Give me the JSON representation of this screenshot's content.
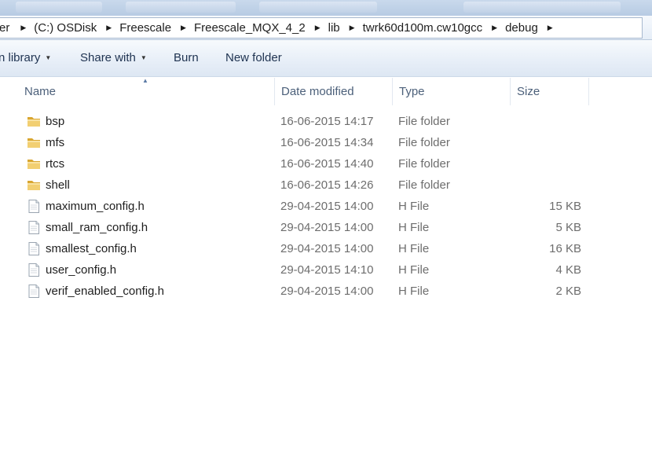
{
  "breadcrumb": {
    "items": [
      {
        "label": "er"
      },
      {
        "label": "(C:) OSDisk"
      },
      {
        "label": "Freescale"
      },
      {
        "label": "Freescale_MQX_4_2"
      },
      {
        "label": "lib"
      },
      {
        "label": "twrk60d100m.cw10gcc"
      },
      {
        "label": "debug"
      }
    ]
  },
  "toolbar": {
    "include_library": "n library",
    "share_with": "Share with",
    "burn": "Burn",
    "new_folder": "New folder"
  },
  "columns": {
    "name": "Name",
    "date_modified": "Date modified",
    "type": "Type",
    "size": "Size"
  },
  "files": [
    {
      "name": "bsp",
      "date": "16-06-2015 14:17",
      "type": "File folder",
      "size": "",
      "icon": "folder-icon"
    },
    {
      "name": "mfs",
      "date": "16-06-2015 14:34",
      "type": "File folder",
      "size": "",
      "icon": "folder-icon"
    },
    {
      "name": "rtcs",
      "date": "16-06-2015 14:40",
      "type": "File folder",
      "size": "",
      "icon": "folder-icon"
    },
    {
      "name": "shell",
      "date": "16-06-2015 14:26",
      "type": "File folder",
      "size": "",
      "icon": "folder-icon"
    },
    {
      "name": "maximum_config.h",
      "date": "29-04-2015 14:00",
      "type": "H File",
      "size": "15 KB",
      "icon": "file-icon"
    },
    {
      "name": "small_ram_config.h",
      "date": "29-04-2015 14:00",
      "type": "H File",
      "size": "5 KB",
      "icon": "file-icon"
    },
    {
      "name": "smallest_config.h",
      "date": "29-04-2015 14:00",
      "type": "H File",
      "size": "16 KB",
      "icon": "file-icon"
    },
    {
      "name": "user_config.h",
      "date": "29-04-2015 14:10",
      "type": "H File",
      "size": "4 KB",
      "icon": "file-icon"
    },
    {
      "name": "verif_enabled_config.h",
      "date": "29-04-2015 14:00",
      "type": "H File",
      "size": "2 KB",
      "icon": "file-icon"
    }
  ],
  "colors": {
    "toolbar_text": "#1e3250",
    "header_text": "#4c607a",
    "folder": "#e8b84a"
  }
}
